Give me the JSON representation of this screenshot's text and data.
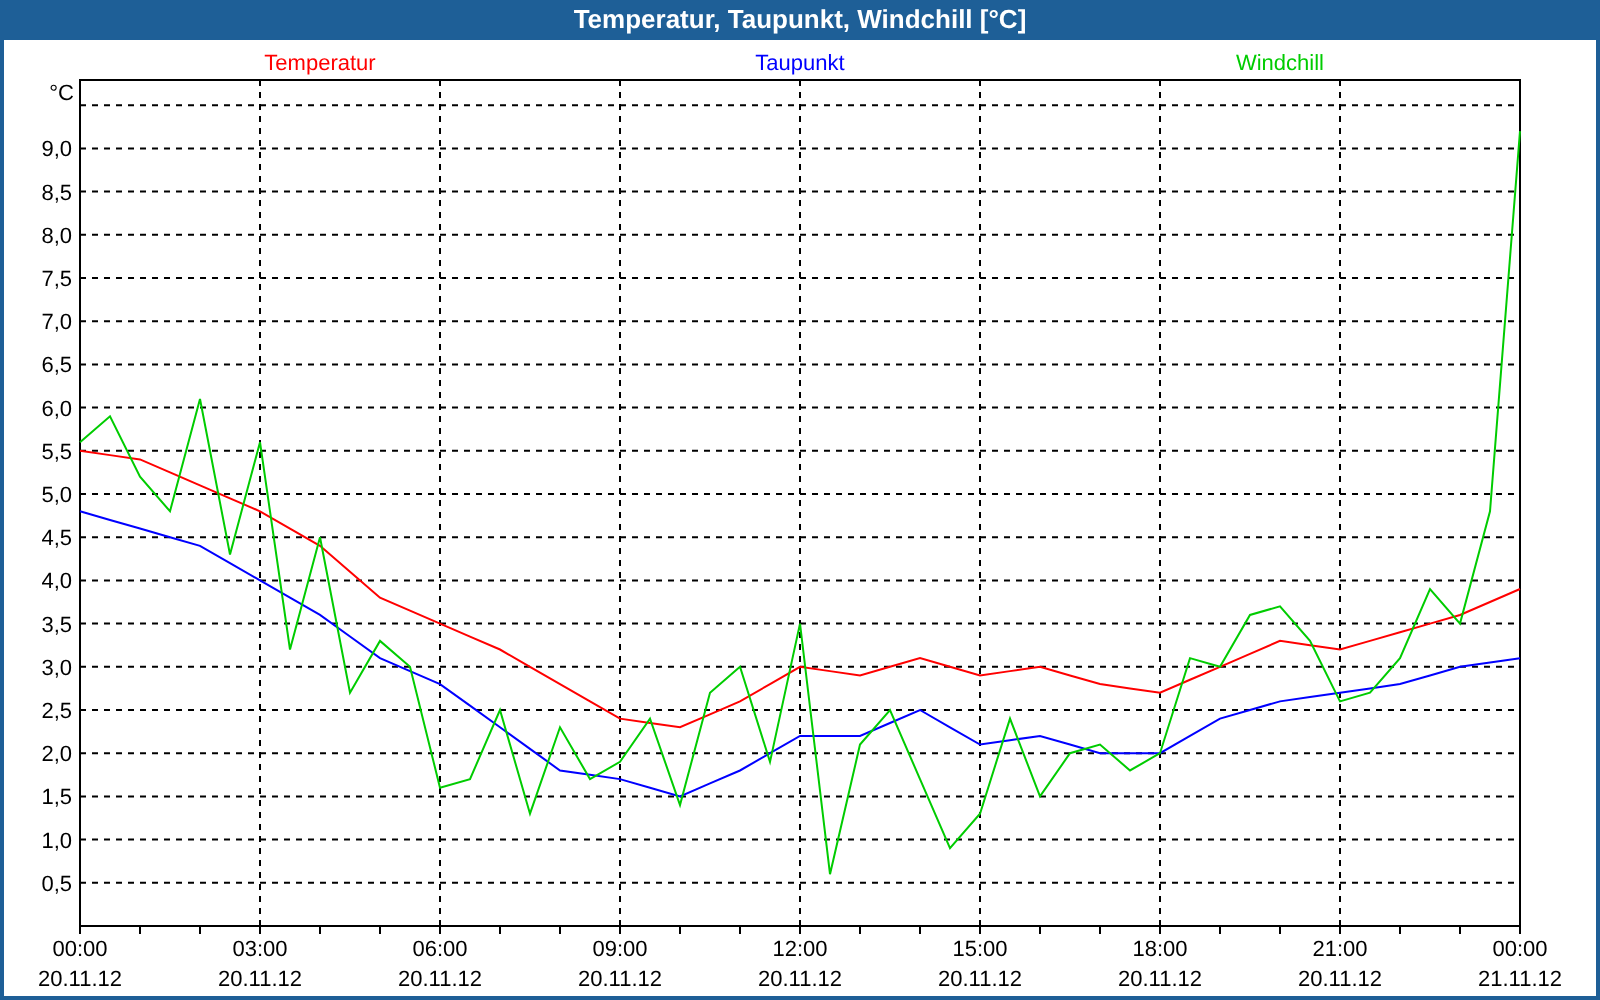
{
  "window": {
    "title": "Temperatur, Taupunkt, Windchill [°C]"
  },
  "chart": {
    "chart_data": {
      "type": "line",
      "ylabel": "°C",
      "categories": [
        "00:00\n20.11.12",
        null,
        null,
        null,
        null,
        null,
        "03:00\n20.11.12",
        null,
        null,
        null,
        null,
        null,
        "06:00\n20.11.12",
        null,
        null,
        null,
        null,
        null,
        "09:00\n20.11.12",
        null,
        null,
        null,
        null,
        null,
        "12:00\n20.11.12",
        null,
        null,
        null,
        null,
        null,
        "15:00\n20.11.12",
        null,
        null,
        null,
        null,
        null,
        "18:00\n20.11.12",
        null,
        null,
        null,
        null,
        null,
        "21:00\n20.11.12",
        null,
        null,
        null,
        null,
        null,
        "00:00\n21.11.12"
      ],
      "series": [
        {
          "name": "Temperatur",
          "color": "#ff0000",
          "values": [
            5.5,
            5.45,
            5.4,
            5.25,
            5.1,
            4.95,
            4.8,
            4.6,
            4.4,
            4.1,
            3.8,
            3.65,
            3.5,
            3.35,
            3.2,
            3.0,
            2.8,
            2.6,
            2.4,
            2.35,
            2.3,
            2.45,
            2.6,
            2.8,
            3.0,
            2.95,
            2.9,
            3.0,
            3.1,
            3.0,
            2.9,
            2.95,
            3.0,
            2.9,
            2.8,
            2.75,
            2.7,
            2.85,
            3.0,
            3.15,
            3.3,
            3.25,
            3.2,
            3.3,
            3.4,
            3.5,
            3.6,
            3.75,
            3.9
          ]
        },
        {
          "name": "Taupunkt",
          "color": "#0000ff",
          "values": [
            4.8,
            4.7,
            4.6,
            4.5,
            4.4,
            4.2,
            4.0,
            3.8,
            3.6,
            3.35,
            3.1,
            2.95,
            2.8,
            2.55,
            2.3,
            2.05,
            1.8,
            1.75,
            1.7,
            1.6,
            1.5,
            1.65,
            1.8,
            2.0,
            2.2,
            2.2,
            2.2,
            2.35,
            2.5,
            2.3,
            2.1,
            2.15,
            2.2,
            2.1,
            2.0,
            2.0,
            2.0,
            2.2,
            2.4,
            2.5,
            2.6,
            2.65,
            2.7,
            2.75,
            2.8,
            2.9,
            3.0,
            3.05,
            3.1
          ]
        },
        {
          "name": "Windchill",
          "color": "#00cc00",
          "values": [
            5.6,
            5.9,
            5.2,
            4.8,
            6.1,
            4.3,
            5.6,
            3.2,
            4.5,
            2.7,
            3.3,
            3.0,
            1.6,
            1.7,
            2.5,
            1.3,
            2.3,
            1.7,
            1.9,
            2.4,
            1.4,
            2.7,
            3.0,
            1.9,
            3.5,
            0.6,
            2.1,
            2.5,
            1.7,
            0.9,
            1.3,
            2.4,
            1.5,
            2.0,
            2.1,
            1.8,
            2.0,
            3.1,
            3.0,
            3.6,
            3.7,
            3.3,
            2.6,
            2.7,
            3.1,
            3.9,
            3.5,
            4.8,
            9.2
          ]
        }
      ],
      "ylim": [
        0,
        9.5
      ],
      "grid": true,
      "yticks": [
        {
          "value": 0.5,
          "label": "0,5"
        },
        {
          "value": 1,
          "label": "1,0"
        },
        {
          "value": 1.5,
          "label": "1,5"
        },
        {
          "value": 2,
          "label": "2,0"
        },
        {
          "value": 2.5,
          "label": "2,5"
        },
        {
          "value": 3,
          "label": "3,0"
        },
        {
          "value": 3.5,
          "label": "3,5"
        },
        {
          "value": 4,
          "label": "4,0"
        },
        {
          "value": 4.5,
          "label": "4,5"
        },
        {
          "value": 5,
          "label": "5,0"
        },
        {
          "value": 5.5,
          "label": "5,5"
        },
        {
          "value": 6,
          "label": "6,0"
        },
        {
          "value": 6.5,
          "label": "6,5"
        },
        {
          "value": 7,
          "label": "7,0"
        },
        {
          "value": 7.5,
          "label": "7,5"
        },
        {
          "value": 8,
          "label": "8,0"
        },
        {
          "value": 8.5,
          "label": "8,5"
        },
        {
          "value": 9,
          "label": "9,0"
        }
      ]
    }
  }
}
